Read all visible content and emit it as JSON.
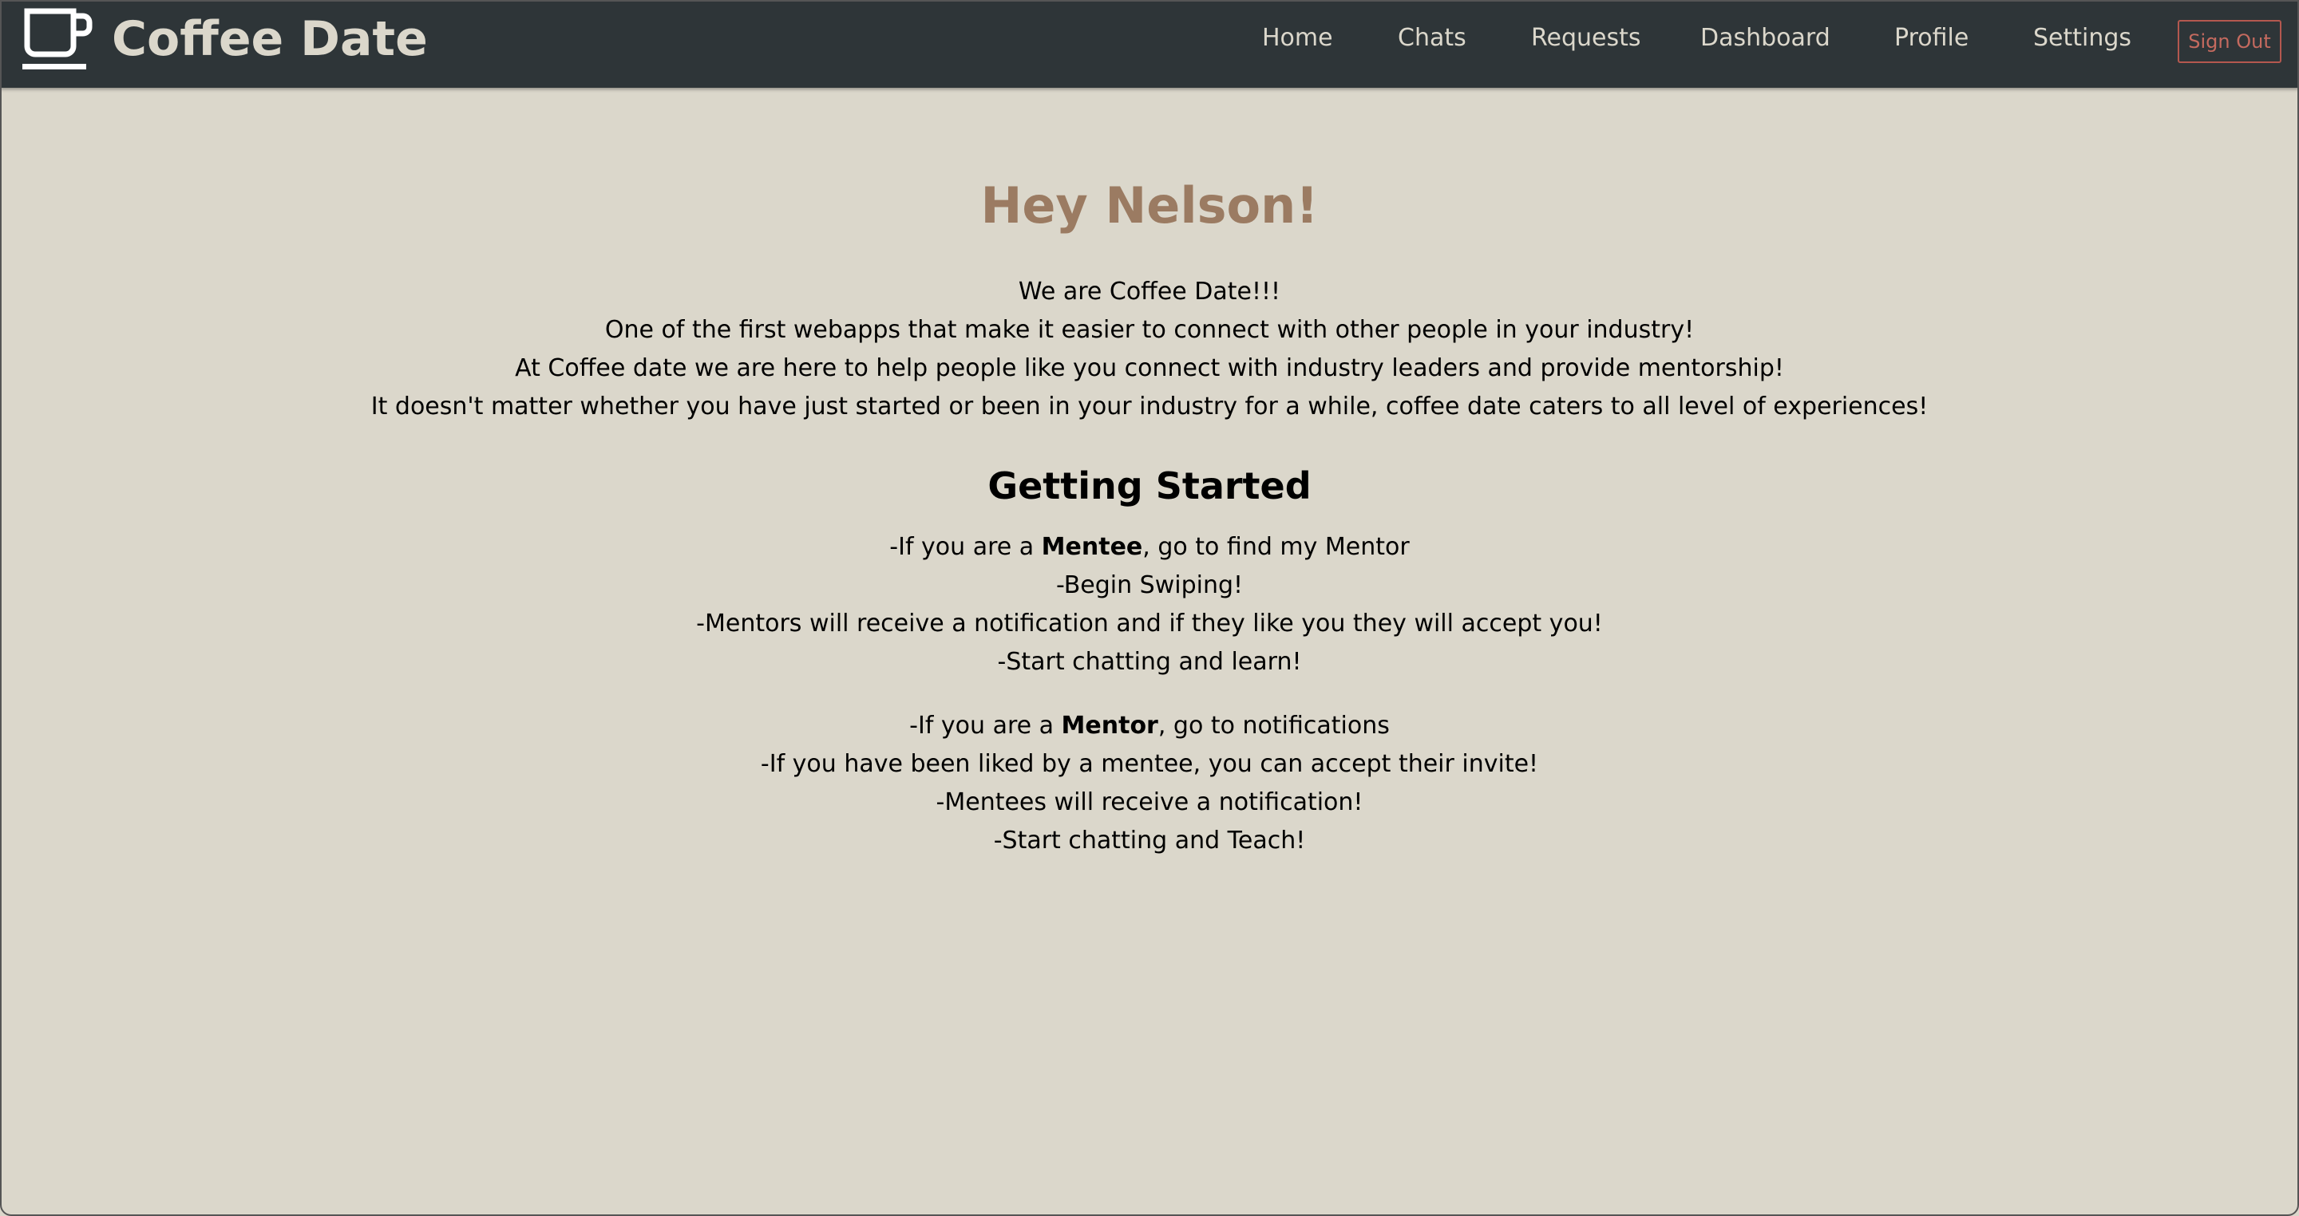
{
  "header": {
    "brand": "Coffee Date",
    "logo_icon": "coffee-cup-icon",
    "nav": [
      {
        "label": "Home"
      },
      {
        "label": "Chats"
      },
      {
        "label": "Requests"
      },
      {
        "label": "Dashboard"
      },
      {
        "label": "Profile"
      },
      {
        "label": "Settings"
      }
    ],
    "sign_out": "Sign Out"
  },
  "main": {
    "greeting": "Hey Nelson!",
    "intro": [
      "We are Coffee Date!!!",
      "One of the first webapps that make it easier to connect with other people in your industry!",
      "At Coffee date we are here to help people like you connect with industry leaders and provide mentorship!",
      "It doesn't matter whether you have just started or been in your industry for a while, coffee date caters to all level of experiences!"
    ],
    "getting_started_title": "Getting Started",
    "mentee": {
      "prefix": "-If you are a ",
      "role": "Mentee",
      "suffix": ", go to find my Mentor",
      "steps": [
        "-Begin Swiping!",
        "-Mentors will receive a notification and if they like you they will accept you!",
        "-Start chatting and learn!"
      ]
    },
    "mentor": {
      "prefix": "-If you are a ",
      "role": "Mentor",
      "suffix": ", go to notifications",
      "steps": [
        "-If you have been liked by a mentee, you can accept their invite!",
        "-Mentees will receive a notification!",
        "-Start chatting and Teach!"
      ]
    }
  },
  "colors": {
    "navbar": "#2e3538",
    "background": "#dbd7cb",
    "greeting": "#9b7b62",
    "sign_out": "#c46a5f"
  }
}
